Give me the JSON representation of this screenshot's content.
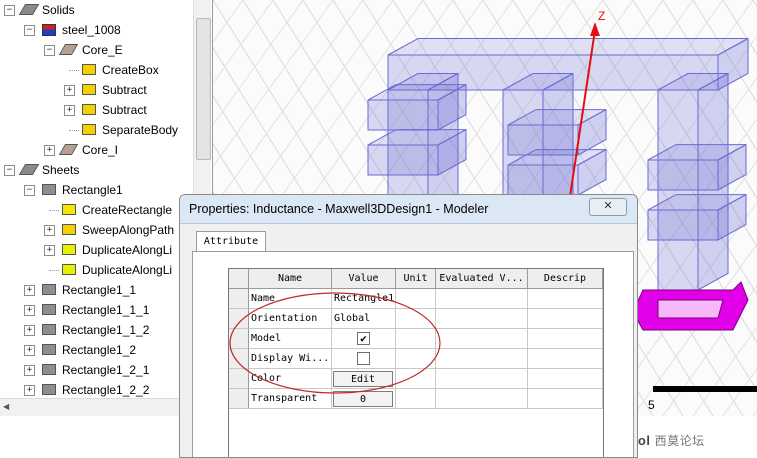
{
  "tree": {
    "nodes": [
      {
        "label": "Solids",
        "icon": "solids-folder-icon",
        "expander": "−"
      },
      {
        "label": "steel_1008",
        "icon": "material-icon",
        "expander": "−"
      },
      {
        "label": "Core_E",
        "icon": "solid-object-icon",
        "expander": "−"
      },
      {
        "label": "CreateBox",
        "icon": "create-box-icon",
        "expander": ""
      },
      {
        "label": "Subtract",
        "icon": "subtract-icon",
        "expander": "+"
      },
      {
        "label": "Subtract",
        "icon": "subtract-icon",
        "expander": "+"
      },
      {
        "label": "SeparateBody",
        "icon": "separate-body-icon",
        "expander": ""
      },
      {
        "label": "Core_I",
        "icon": "solid-object-icon",
        "expander": "+"
      },
      {
        "label": "Sheets",
        "icon": "sheets-folder-icon",
        "expander": "−"
      },
      {
        "label": "Rectangle1",
        "icon": "sheet-icon",
        "expander": "−"
      },
      {
        "label": "CreateRectangle",
        "icon": "create-rectangle-icon",
        "expander": ""
      },
      {
        "label": "SweepAlongPath",
        "icon": "sweep-icon",
        "expander": "+"
      },
      {
        "label": "DuplicateAlongLi",
        "icon": "duplicate-icon",
        "expander": "+"
      },
      {
        "label": "DuplicateAlongLi",
        "icon": "duplicate-icon",
        "expander": ""
      },
      {
        "label": "Rectangle1_1",
        "icon": "sheet-icon",
        "expander": "+"
      },
      {
        "label": "Rectangle1_1_1",
        "icon": "sheet-icon",
        "expander": "+"
      },
      {
        "label": "Rectangle1_1_2",
        "icon": "sheet-icon",
        "expander": "+"
      },
      {
        "label": "Rectangle1_2",
        "icon": "sheet-icon",
        "expander": "+"
      },
      {
        "label": "Rectangle1_2_1",
        "icon": "sheet-icon",
        "expander": "+"
      },
      {
        "label": "Rectangle1_2_2",
        "icon": "sheet-icon",
        "expander": "+"
      }
    ]
  },
  "view": {
    "axis_label": "Z",
    "scale_value": "5",
    "highlight_color": "#e100e8",
    "wire_color": "#6a6ad4",
    "axis_color": "#e01010"
  },
  "dialog": {
    "title": "Properties: Inductance - Maxwell3DDesign1 - Modeler",
    "close_label": "✕",
    "tab_label": "Attribute",
    "columns": [
      "Name",
      "Value",
      "Unit",
      "Evaluated V...",
      "Descrip"
    ],
    "rows": [
      {
        "name": "Name",
        "value": "Rectangle1",
        "kind": "text"
      },
      {
        "name": "Orientation",
        "value": "Global",
        "kind": "text"
      },
      {
        "name": "Model",
        "value": "✔",
        "kind": "checkbox",
        "checked": true
      },
      {
        "name": "Display Wi...",
        "value": "",
        "kind": "checkbox",
        "checked": false
      },
      {
        "name": "Color",
        "value": "Edit",
        "kind": "button"
      },
      {
        "name": "Transparent",
        "value": "0",
        "kind": "button"
      }
    ]
  },
  "watermark": {
    "brand": "simol",
    "cn": "西莫论坛"
  }
}
